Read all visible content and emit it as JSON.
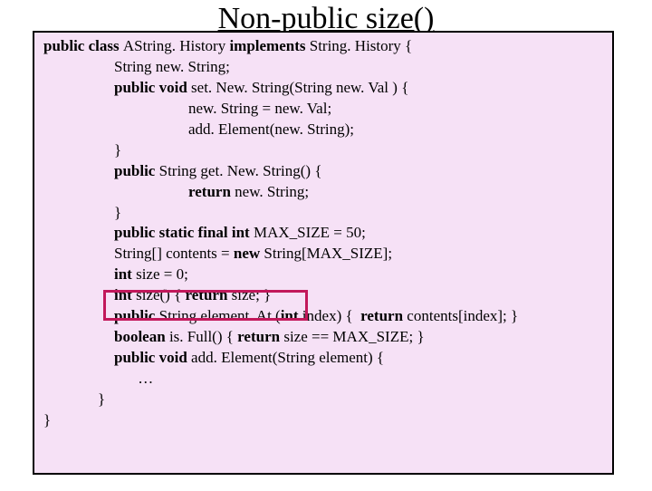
{
  "title": "Non-public size()",
  "code": {
    "l1a": "public class ",
    "l1b": "AString. History ",
    "l1c": "implements ",
    "l1d": "String. History {",
    "l2": "String new. String;",
    "l3a": "public void ",
    "l3b": "set. New. String(String new. Val ) {",
    "l4": "new. String = new. Val;",
    "l5": "add. Element(new. String);",
    "l6": "}",
    "l7a": "public ",
    "l7b": "String get. New. String() {",
    "l8a": "return ",
    "l8b": "new. String;",
    "l9": "}",
    "l10a": "public static final int ",
    "l10b": "MAX_SIZE = 50;",
    "l11a": "String[] contents = ",
    "l11b": "new ",
    "l11c": "String[MAX_SIZE];",
    "l12a": "int ",
    "l12b": "size = 0;",
    "l13a": "int ",
    "l13b": "size() { ",
    "l13c": "return ",
    "l13d": "size; }",
    "l14a": "public ",
    "l14b": "String element. At (",
    "l14c": "int ",
    "l14d": "index) {  ",
    "l14e": "return ",
    "l14f": "contents[index]; }",
    "l15a": "boolean ",
    "l15b": "is. Full() { ",
    "l15c": "return ",
    "l15d": "size == MAX_SIZE; }",
    "l16a": "public void ",
    "l16b": "add. Element(String element) {",
    "l17": " …",
    "l18": "}",
    "l19": "}"
  }
}
